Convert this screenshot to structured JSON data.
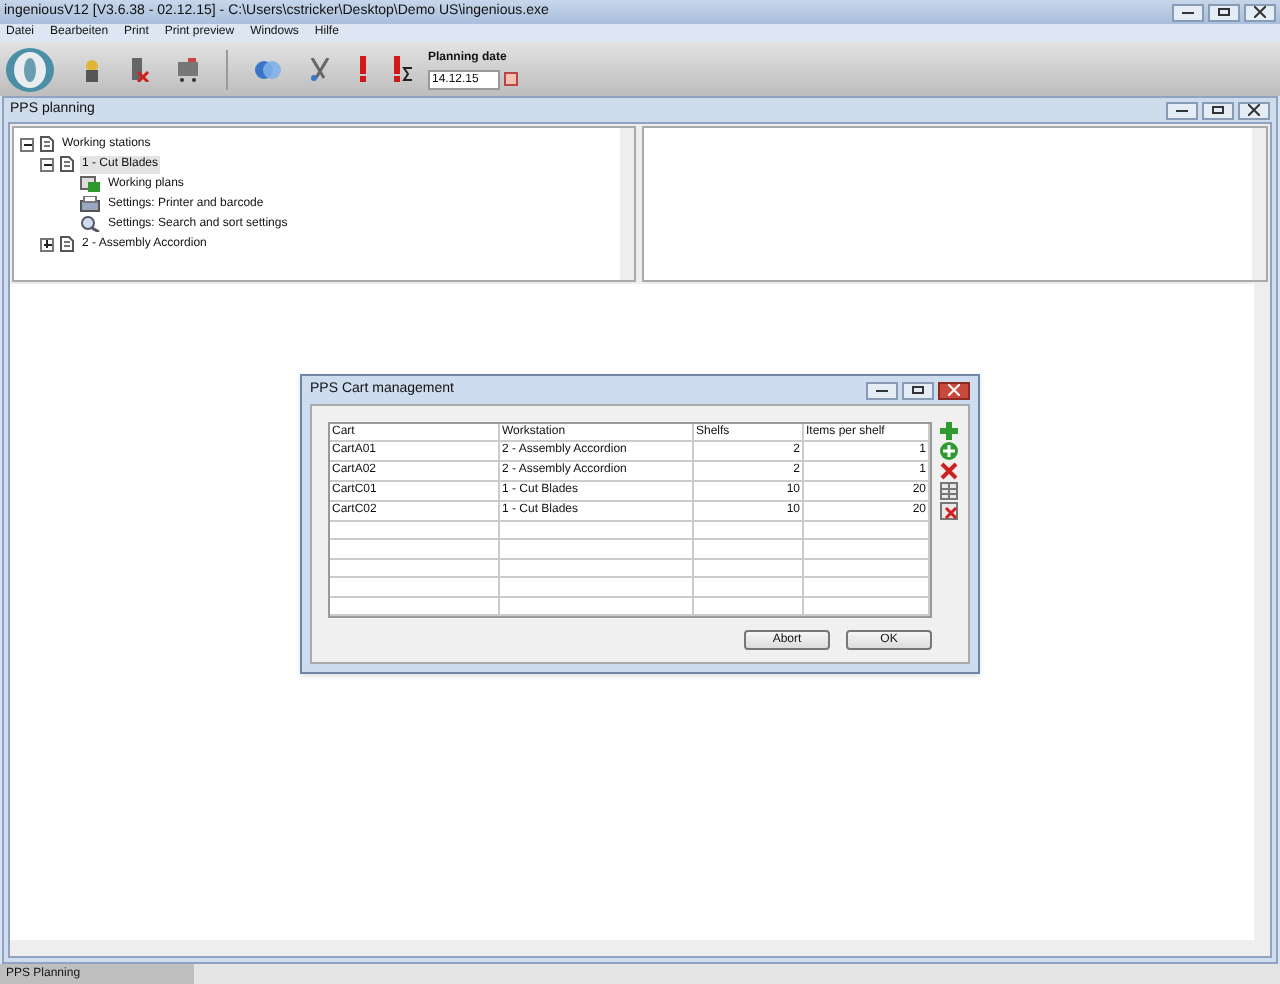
{
  "window": {
    "title": "ingeniousV12 [V3.6.38 - 02.12.15] - C:\\Users\\cstricker\\Desktop\\Demo US\\ingenious.exe"
  },
  "menu": [
    "Datei",
    "Bearbeiten",
    "Print",
    "Print preview",
    "Windows",
    "Hilfe"
  ],
  "toolbar": {
    "planning_date": {
      "label": "Planning date",
      "value": "14.12.15"
    }
  },
  "child_window": {
    "title": "PPS planning",
    "tree": [
      {
        "label": "Working stations",
        "kind": "doc",
        "expanded": true,
        "selected": false,
        "children": [
          {
            "label": "1 - Cut Blades",
            "kind": "doc",
            "expanded": true,
            "selected": true,
            "children": [
              {
                "label": "Working plans",
                "kind": "plan",
                "selected": false
              },
              {
                "label": "Settings: Printer and barcode",
                "kind": "printer",
                "selected": false
              },
              {
                "label": "Settings: Search and sort settings",
                "kind": "search",
                "selected": false
              }
            ]
          },
          {
            "label": "2 - Assembly Accordion",
            "kind": "doc",
            "expanded": false,
            "selected": false
          }
        ]
      }
    ]
  },
  "dialog": {
    "title": "PPS Cart management",
    "table": {
      "columns": [
        "Cart",
        "Workstation",
        "Shelfs",
        "Items per shelf"
      ],
      "rows": [
        [
          "CartA01",
          "2 - Assembly Accordion",
          "2",
          "1"
        ],
        [
          "CartA02",
          "2 - Assembly Accordion",
          "2",
          "1"
        ],
        [
          "CartC01",
          "1 - Cut Blades",
          "10",
          "20"
        ],
        [
          "CartC02",
          "1 - Cut Blades",
          "10",
          "20"
        ]
      ]
    },
    "side_tools": [
      {
        "kind": "add"
      },
      {
        "kind": "add-round"
      },
      {
        "kind": "delete"
      },
      {
        "kind": "grid"
      },
      {
        "kind": "grid-delete"
      }
    ],
    "buttons": [
      "Abort",
      "OK"
    ]
  },
  "taskbar": [
    {
      "label": "PPS Planning",
      "selected": true
    }
  ]
}
